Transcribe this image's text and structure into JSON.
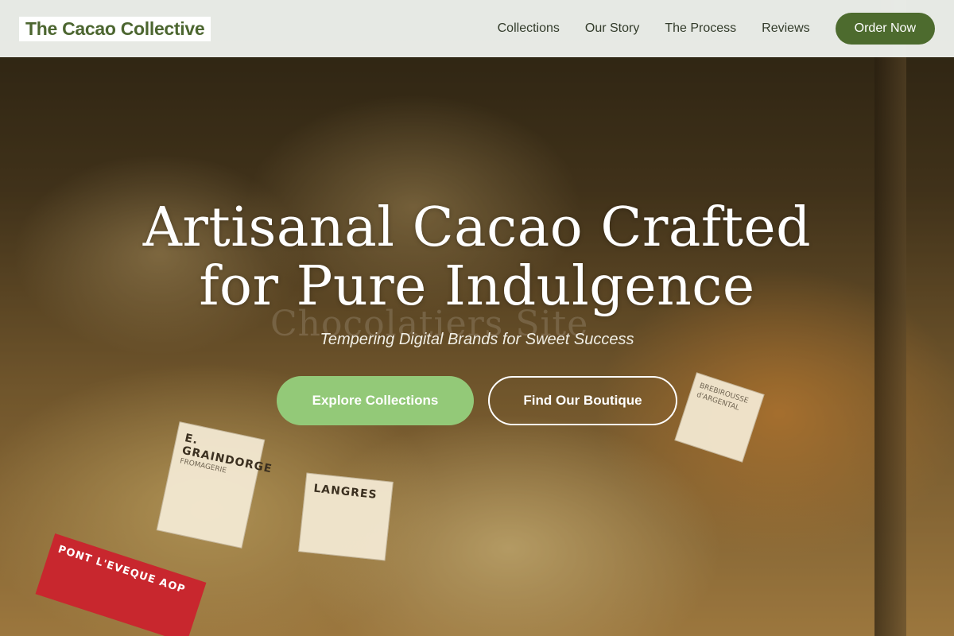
{
  "brand": {
    "name": "The Cacao Collective",
    "color": "#4c6630"
  },
  "nav": {
    "links": [
      "Collections",
      "Our Story",
      "The Process",
      "Reviews"
    ],
    "cta_label": "Order Now",
    "cta_color": "#4d6b2e"
  },
  "hero": {
    "headline_line1": "Artisanal Cacao Crafted",
    "headline_line2": "for Pure Indulgence",
    "subheadline": "Tempering Digital Brands for Sweet Success",
    "background_text": "Chocolatiers Site",
    "primary_cta": "Explore Collections",
    "secondary_cta": "Find Our Boutique",
    "primary_color": "#93c978"
  },
  "labels": {
    "tag1_title": "E. GRAINDORGE",
    "tag1_sub": "FROMAGERIE",
    "tag2_title": "LANGRES",
    "tag3_title": "BREBIROUSSE d'ARGENTAL",
    "tag4_title": "PONT L'EVEQUE AOP"
  }
}
